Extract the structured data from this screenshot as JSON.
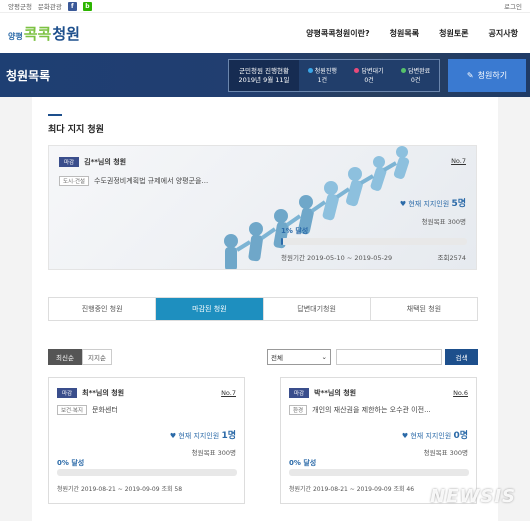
{
  "topbar": {
    "links": [
      "양평군청",
      "문화관광"
    ],
    "login": "로그인"
  },
  "header": {
    "logo_small": "양평",
    "logo_mid": "콕콕",
    "logo_main": "청원",
    "nav": [
      "양평콕콕청원이란?",
      "청원목록",
      "청원토론",
      "공지사항"
    ]
  },
  "banner": {
    "title": "청원목록",
    "stat_title": "군민청원 진행현황",
    "stat_date": "2019년 9월 11일",
    "stats": [
      {
        "label": "청원진행",
        "value": "1건",
        "color": "#3aa6e8"
      },
      {
        "label": "답변대기",
        "value": "0건",
        "color": "#e84a7a"
      },
      {
        "label": "답변완료",
        "value": "0건",
        "color": "#55c16a"
      }
    ],
    "button": "청원하기"
  },
  "section": {
    "title": "최다 지지 청원"
  },
  "featured": {
    "badge": "마감",
    "name": "김**님의 청원",
    "no": "No.7",
    "category": "도시·건설",
    "summary": "수도권정비계획법 규제에서 양평군을...",
    "supporters_label": "현재 지지인원",
    "supporters": "5명",
    "goal": "청원목표 300명",
    "achieve": "1% 달성",
    "period": "청원기간 2019-05-10 ~ 2019-05-29",
    "views": "조회2574",
    "progress": 0.01
  },
  "tabs": [
    "진행중인 청원",
    "마감된 청원",
    "답변대기청원",
    "채택된 청원"
  ],
  "sort": {
    "latest": "최신순",
    "support": "지지순",
    "filter": "전체",
    "search": "검색"
  },
  "cards": [
    {
      "badge": "마감",
      "name": "최**님의 청원",
      "no": "No.7",
      "category": "보건·복지",
      "summary": "문화센터",
      "supporters_label": "현재 지지인원",
      "supporters": "1명",
      "goal": "청원목표 300명",
      "achieve": "0% 달성",
      "period": "청원기간 2019-08-21 ~ 2019-09-09 조회 58",
      "progress": 0
    },
    {
      "badge": "마감",
      "name": "박**님의 청원",
      "no": "No.6",
      "category": "환경",
      "summary": "개인의 재산권을 제한하는 오수관 이전...",
      "supporters_label": "현재 지지인원",
      "supporters": "0명",
      "goal": "청원목표 300명",
      "achieve": "0% 달성",
      "period": "청원기간 2019-08-21 ~ 2019-09-09 조회 46",
      "progress": 0
    }
  ],
  "watermark": "NEWSIS"
}
